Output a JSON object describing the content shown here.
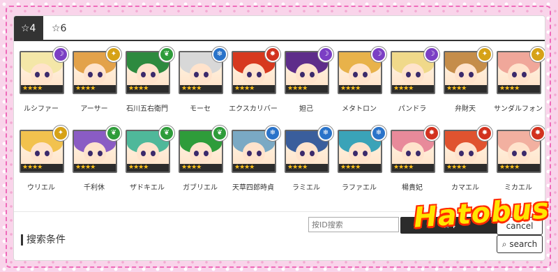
{
  "tabs": [
    {
      "label": "☆4",
      "active": true
    },
    {
      "label": "☆6",
      "active": false
    }
  ],
  "characters": [
    {
      "name": "ルシファー",
      "element": "dark",
      "element_icon": "dark-orb-icon",
      "hair": "#f4e7a8"
    },
    {
      "name": "アーサー",
      "element": "light",
      "element_icon": "light-orb-icon",
      "hair": "#e3a24a"
    },
    {
      "name": "石川五右衛門",
      "element": "wood",
      "element_icon": "wood-orb-icon",
      "hair": "#2d8a3f"
    },
    {
      "name": "モーセ",
      "element": "water",
      "element_icon": "water-orb-icon",
      "hair": "#d8d8d8"
    },
    {
      "name": "エクスカリバー",
      "element": "fire",
      "element_icon": "fire-orb-icon",
      "hair": "#d7391f"
    },
    {
      "name": "妲己",
      "element": "dark",
      "element_icon": "dark-orb-icon",
      "hair": "#5e2d8a"
    },
    {
      "name": "メタトロン",
      "element": "dark",
      "element_icon": "dark-orb-icon",
      "hair": "#e8b24a"
    },
    {
      "name": "パンドラ",
      "element": "dark",
      "element_icon": "dark-orb-icon",
      "hair": "#f0d98a"
    },
    {
      "name": "弁財天",
      "element": "light",
      "element_icon": "light-orb-icon",
      "hair": "#c58d4a"
    },
    {
      "name": "サンダルフォン",
      "element": "light",
      "element_icon": "light-orb-icon",
      "hair": "#f0a79a"
    },
    {
      "name": "ウリエル",
      "element": "light",
      "element_icon": "light-orb-icon",
      "hair": "#f2c24e"
    },
    {
      "name": "千利休",
      "element": "wood",
      "element_icon": "wood-orb-icon",
      "hair": "#8a5cc4"
    },
    {
      "name": "ザドキエル",
      "element": "wood",
      "element_icon": "wood-orb-icon",
      "hair": "#4fb89a"
    },
    {
      "name": "ガブリエル",
      "element": "wood",
      "element_icon": "wood-orb-icon",
      "hair": "#2e9c3a"
    },
    {
      "name": "天草四郎時貞",
      "element": "water",
      "element_icon": "water-orb-icon",
      "hair": "#7aa9c4"
    },
    {
      "name": "ラミエル",
      "element": "water",
      "element_icon": "water-orb-icon",
      "hair": "#3a5e9c"
    },
    {
      "name": "ラファエル",
      "element": "water",
      "element_icon": "water-orb-icon",
      "hair": "#3aa3b8"
    },
    {
      "name": "楊貴妃",
      "element": "fire",
      "element_icon": "fire-orb-icon",
      "hair": "#e88a9a"
    },
    {
      "name": "カマエル",
      "element": "fire",
      "element_icon": "fire-orb-icon",
      "hair": "#e0532f"
    },
    {
      "name": "ミカエル",
      "element": "fire",
      "element_icon": "fire-orb-icon",
      "hair": "#f2b0a0"
    }
  ],
  "rarity_stars": "★★★★",
  "search": {
    "title": "搜索条件",
    "id_placeholder": "按ID搜索",
    "sort_label": "☆4",
    "cancel_label": "cancel",
    "search_label": "search",
    "search_icon": "magnifier-icon"
  },
  "watermark": "Hatobus",
  "colors": {
    "dark": "#7b3fc4",
    "light": "#d6a217",
    "wood": "#2e9c3a",
    "water": "#2a73c9",
    "fire": "#d2321f",
    "frame": "#ef6bbb",
    "background": "#f9d4ea"
  }
}
